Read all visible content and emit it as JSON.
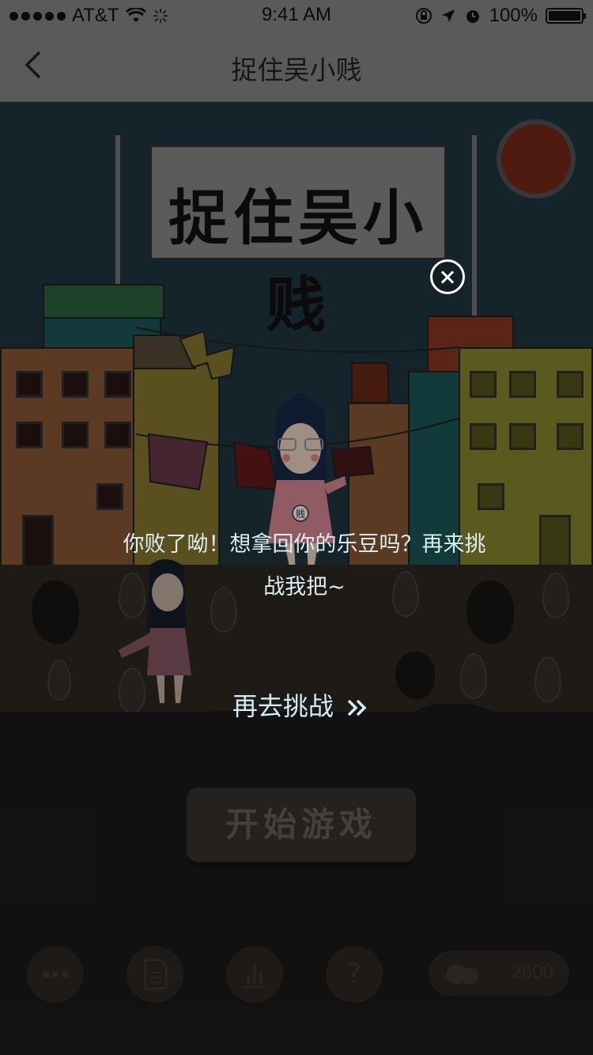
{
  "status_bar": {
    "carrier": "AT&T",
    "time": "9:41 AM",
    "battery": "100%",
    "battery_level": 1.0,
    "icons": [
      "signal-dots-icon",
      "wifi-icon",
      "loading-spinner-icon",
      "rotation-lock-icon",
      "location-arrow-icon",
      "alarm-icon",
      "battery-icon"
    ]
  },
  "nav": {
    "title": "捉住吴小贱",
    "back_icon": "chevron-left-icon"
  },
  "scene": {
    "banner_text": "捉住吴小贱",
    "character_badge": "贱"
  },
  "dialog": {
    "message": "你败了呦！想拿回你的乐豆吗？再来挑战我把~",
    "retry_label": "再去挑战",
    "retry_icon": "double-chevron-right-icon",
    "close_icon": "close-circle-icon"
  },
  "main": {
    "start_button_label": "开始游戏"
  },
  "toolbar": {
    "buttons": [
      {
        "icon": "more-dots-icon"
      },
      {
        "icon": "document-icon"
      },
      {
        "icon": "bar-chart-icon"
      },
      {
        "icon": "help-question-icon",
        "label": "?"
      }
    ],
    "beans_count": "2600",
    "beans_icon": "beans-icon"
  },
  "colors": {
    "accent_text": "#dbeff2",
    "scene_bg": "#1f3841",
    "dirt": "#2f2822"
  }
}
